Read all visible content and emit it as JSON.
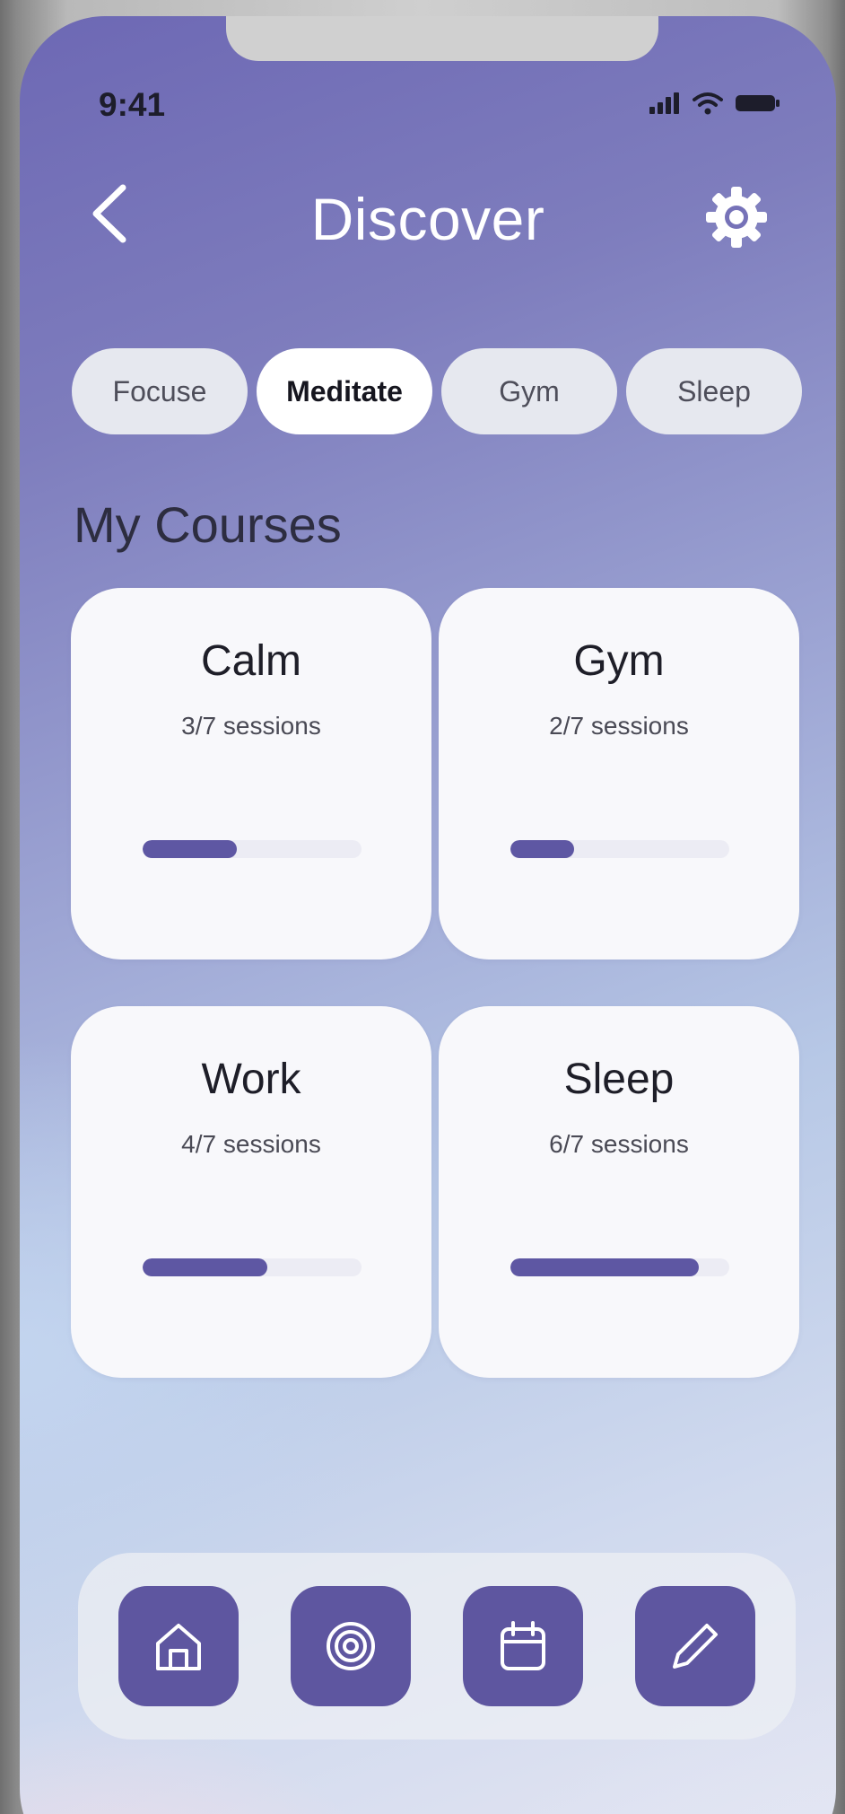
{
  "status_bar": {
    "time": "9:41"
  },
  "header": {
    "title": "Discover",
    "back_icon": "chevron-left-icon",
    "settings_icon": "gear-icon"
  },
  "tabs": [
    {
      "label": "Focuse",
      "active": false
    },
    {
      "label": "Meditate",
      "active": true
    },
    {
      "label": "Gym",
      "active": false
    },
    {
      "label": "Sleep",
      "active": false
    }
  ],
  "section": {
    "title": "My Courses"
  },
  "courses": [
    {
      "title": "Calm",
      "sessions": "3/7 sessions",
      "progress": 0.43
    },
    {
      "title": "Gym",
      "sessions": "2/7 sessions",
      "progress": 0.29
    },
    {
      "title": "Work",
      "sessions": "4/7 sessions",
      "progress": 0.57
    },
    {
      "title": "Sleep",
      "sessions": "6/7 sessions",
      "progress": 0.86
    }
  ],
  "bottom_nav": [
    {
      "icon": "home-icon"
    },
    {
      "icon": "target-icon"
    },
    {
      "icon": "calendar-icon"
    },
    {
      "icon": "pencil-icon"
    }
  ],
  "colors": {
    "accent": "#5e57a3",
    "track": "#ececf4",
    "card": "#f8f8fb"
  }
}
